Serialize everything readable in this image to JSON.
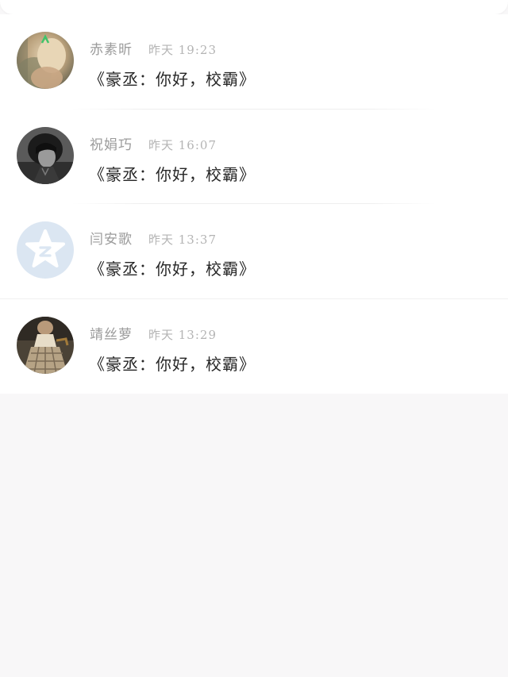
{
  "messages": [
    {
      "name": "赤素昕",
      "time": "昨天 19:23",
      "text": "《豪丞：你好，校霸》",
      "avatar": "photo-blonde-avatar"
    },
    {
      "name": "祝娟巧",
      "time": "昨天 16:07",
      "text": "《豪丞：你好，校霸》",
      "avatar": "photo-dark-hair-avatar"
    },
    {
      "name": "闫安歌",
      "time": "昨天 13:37",
      "text": "《豪丞：你好，校霸》",
      "avatar": "qq-star-default-avatar"
    },
    {
      "name": "靖丝萝",
      "time": "昨天 13:29",
      "text": "《豪丞：你好，校霸》",
      "avatar": "photo-plaid-dress-avatar"
    }
  ],
  "colors": {
    "background": "#f8f7f8",
    "card": "#ffffff",
    "name": "#9b9b9b",
    "time": "#b4b4b4",
    "message": "#262626",
    "default_avatar": "#dbe6f2"
  }
}
